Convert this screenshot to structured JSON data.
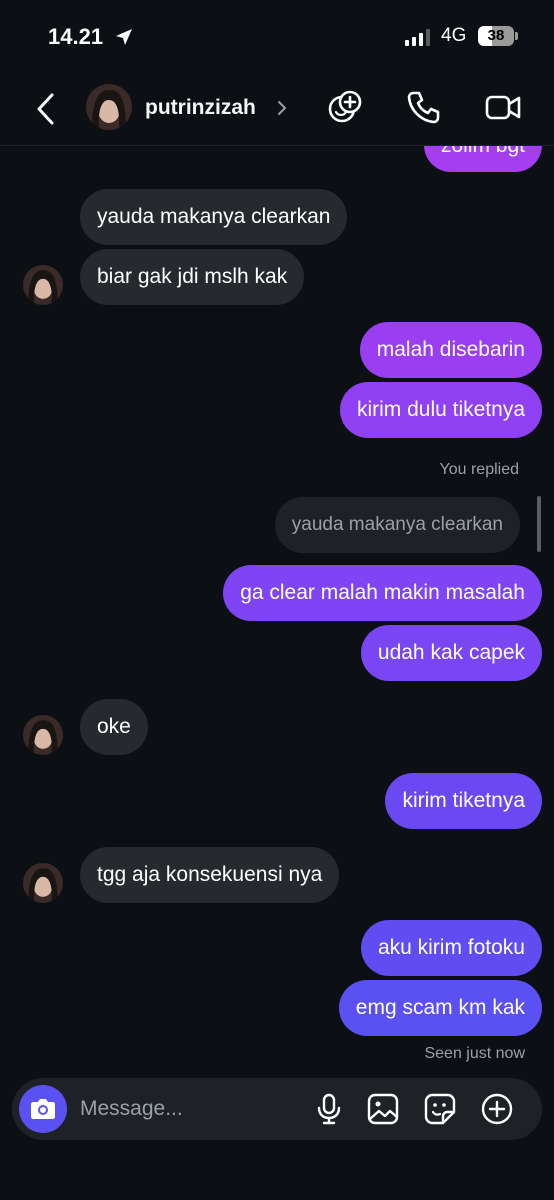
{
  "status_bar": {
    "time": "14.21",
    "network": "4G",
    "battery": "38"
  },
  "header": {
    "username": "putrinzizah"
  },
  "messages": {
    "top_cut": "zolim bgt",
    "m1": "yauda makanya clearkan",
    "m2": "biar gak jdi mslh kak",
    "m3": "malah disebarin",
    "m4": "kirim dulu tiketnya",
    "you_replied": "You replied",
    "quoted": "yauda makanya clearkan",
    "m5": "ga clear malah makin masalah",
    "m6": "udah kak capek",
    "m7": "oke",
    "m8": "kirim tiketnya",
    "m9": "tgg aja konsekuensi nya",
    "m10": "aku kirim fotoku",
    "m11": "emg scam km kak",
    "seen": "Seen just now"
  },
  "composer": {
    "placeholder": "Message..."
  },
  "colors": {
    "background": "#0c1014",
    "received_bubble": "#262a2f",
    "sent_gradient_top": "#a43ef0",
    "sent_gradient_bottom": "#5b51f2",
    "camera_button": "#5b51f2"
  },
  "icons": [
    "location-arrow-icon",
    "back-chevron-icon",
    "chevron-right-icon",
    "effects-icon",
    "phone-icon",
    "video-camera-icon",
    "camera-icon",
    "microphone-icon",
    "gallery-icon",
    "sticker-icon",
    "plus-circle-icon"
  ]
}
